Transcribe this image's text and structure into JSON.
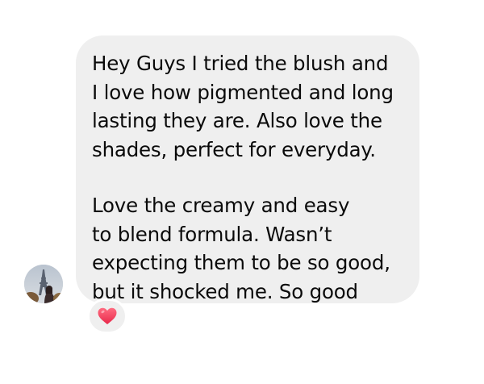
{
  "message": {
    "paragraph1": [
      "Hey Guys I tried the blush and",
      "I love how pigmented and long",
      "lasting they are. Also love the",
      "shades, perfect for everyday."
    ],
    "paragraph2": [
      "Love the creamy and easy",
      "to blend formula. Wasn’t",
      "expecting them to be so good,",
      "but it shocked me. So good"
    ]
  },
  "reaction": {
    "icon": "heart-icon",
    "color": "#f2405a"
  },
  "avatar": {
    "icon": "avatar-eiffel-tower-photo"
  },
  "colors": {
    "bubble": "#efefef",
    "text": "#0a0a0a",
    "background": "#ffffff"
  }
}
